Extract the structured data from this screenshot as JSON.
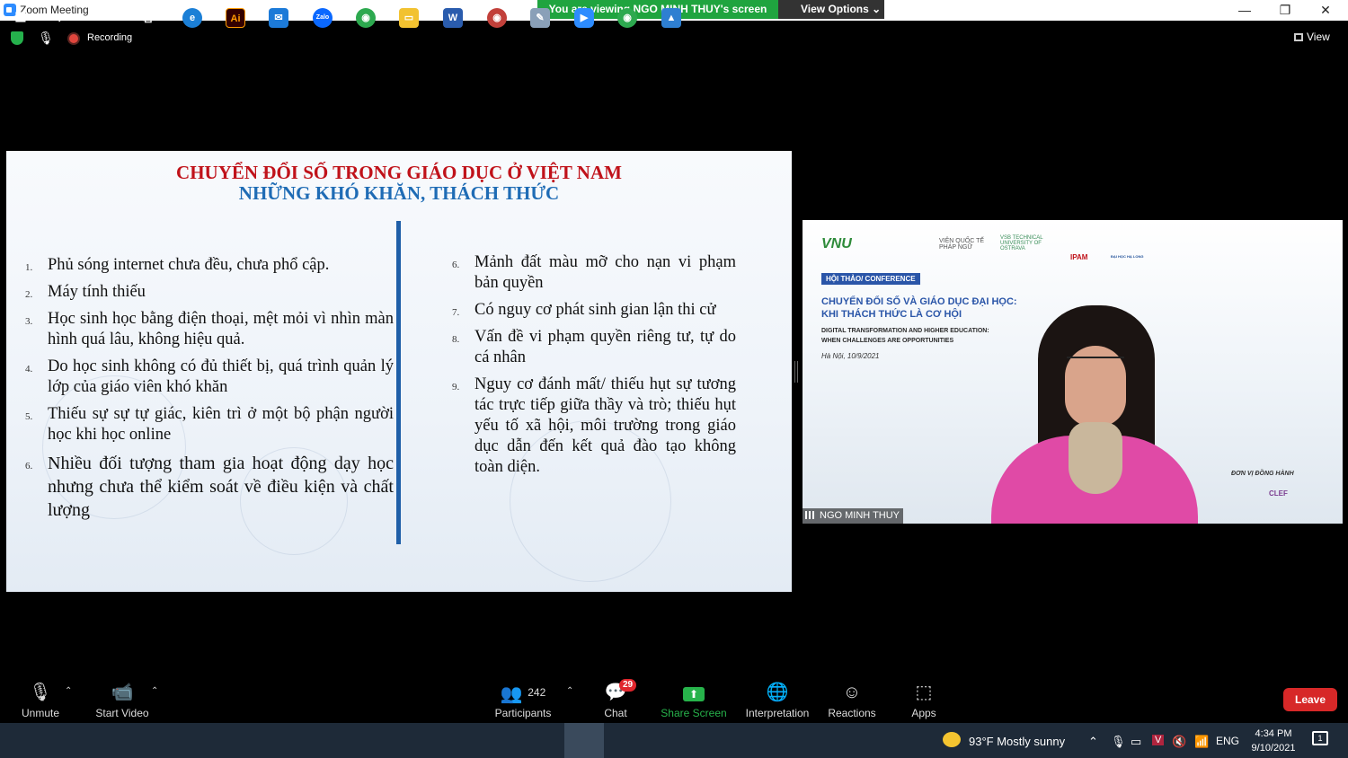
{
  "window": {
    "title": "Zoom Meeting",
    "controls": [
      "—",
      "❐",
      "✕"
    ]
  },
  "banner": {
    "viewing_text": "You are viewing NGO MINH THUY's screen",
    "view_options_label": "View Options ⌄"
  },
  "status": {
    "recording_label": "Recording",
    "view_label": "View"
  },
  "slide": {
    "title_line1": "CHUYỂN ĐỔI SỐ TRONG GIÁO DỤC Ở VIỆT NAM",
    "title_line2": "NHỮNG KHÓ KHĂN, THÁCH THỨC",
    "left_items": [
      {
        "num": "1.",
        "text": "Phủ sóng  internet  chưa đều, chưa phổ cập."
      },
      {
        "num": "2.",
        "text": "Máy tính thiếu"
      },
      {
        "num": "3.",
        "text": "Học sinh học bằng điện thoại, mệt mỏi vì nhìn màn hình quá lâu, không hiệu quả."
      },
      {
        "num": "4.",
        "text": "Do học sinh không có đủ thiết bị, quá trình quản lý lớp của giáo viên khó khăn"
      },
      {
        "num": "5.",
        "text": "Thiếu sự sự tự giác, kiên trì ở một bộ phận người học khi học online"
      },
      {
        "num": "6.",
        "text": "Nhiều đối tượng tham gia hoạt động dạy học nhưng chưa thể kiểm soát về điều kiện và chất lượng"
      }
    ],
    "right_items": [
      {
        "num": "6.",
        "text": "Mảnh đất màu mỡ cho nạn vi phạm bản quyền"
      },
      {
        "num": "7.",
        "text": "Có nguy cơ phát sinh gian lận thi cử"
      },
      {
        "num": "8.",
        "text": "Vấn đề vi phạm quyền riêng tư, tự do cá nhân"
      },
      {
        "num": "9.",
        "text": "Nguy cơ đánh mất/ thiếu hụt sự tương tác trực tiếp giữa thầy và trò; thiếu hụt  yếu tố xã hội, môi trường trong giáo dục dẫn đến kết quả đào tạo không toàn diện."
      }
    ]
  },
  "speaker": {
    "name": "NGO MINH THUY",
    "logos": {
      "vnu": "VNU",
      "vien": "VIỆN QUỐC TẾ PHÁP NGỮ",
      "vsb": "VSB TECHNICAL UNIVERSITY OF OSTRAVA",
      "ipam": "IPAM",
      "ha_long": "ĐẠI HỌC HẠ LONG"
    },
    "badge": "HỘI THẢO/ CONFERENCE",
    "conf_title_1": "CHUYỂN ĐỔI SỐ VÀ GIÁO DỤC ĐẠI HỌC:",
    "conf_title_2": "KHI THÁCH THỨC LÀ CƠ HỘI",
    "conf_sub_1": "DIGITAL TRANSFORMATION AND HIGHER EDUCATION:",
    "conf_sub_2": "WHEN CHALLENGES ARE OPPORTUNITIES",
    "conf_date": "Hà Nội, 10/9/2021",
    "partner_label": "ĐƠN VỊ ĐỒNG HÀNH",
    "clef": "CLEF"
  },
  "toolbar": {
    "unmute": "Unmute",
    "start_video": "Start Video",
    "participants_count": "242",
    "participants": "Participants",
    "chat": "Chat",
    "chat_badge": "29",
    "share_screen": "Share Screen",
    "interpretation": "Interpretation",
    "reactions": "Reactions",
    "apps": "Apps",
    "leave": "Leave"
  },
  "taskbar": {
    "weather": "93°F  Mostly sunny",
    "lang": "ENG",
    "time": "4:34 PM",
    "date": "9/10/2021",
    "notif_count": "1",
    "ai_label": "Ai",
    "zalo_label": "Zalo",
    "word_label": "W"
  },
  "colors": {
    "slide_title_red": "#c0121a",
    "slide_title_blue": "#1f6cb5",
    "banner_green": "#1fa43f",
    "leave_red": "#d72828",
    "share_green": "#27b34b"
  }
}
